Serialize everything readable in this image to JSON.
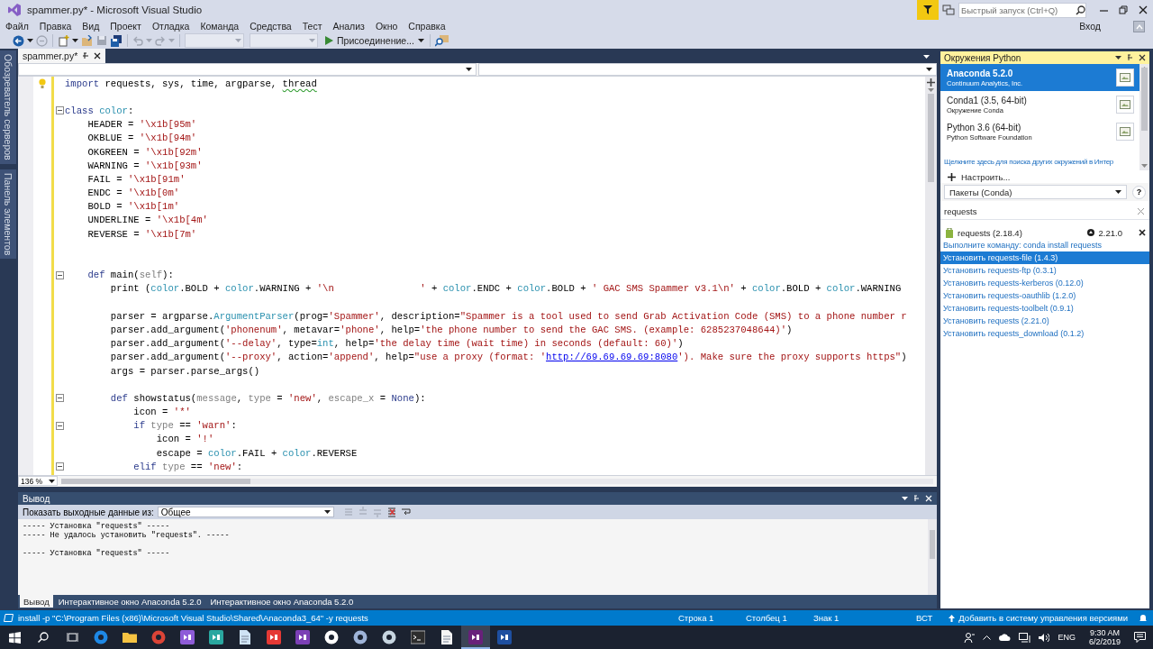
{
  "window": {
    "title": "spammer.py* - Microsoft Visual Studio",
    "quick_launch": {
      "placeholder": "Быстрый запуск (Ctrl+Q)"
    },
    "sign_in": "Вход"
  },
  "menu": [
    "Файл",
    "Правка",
    "Вид",
    "Проект",
    "Отладка",
    "Команда",
    "Средства",
    "Тест",
    "Анализ",
    "Окно",
    "Справка"
  ],
  "toolbar": {
    "start_button": "Присоединение..."
  },
  "side_tabs": [
    "Обозреватель серверов",
    "Панель элементов"
  ],
  "document_tabs": [
    {
      "label": "spammer.py*",
      "selected": true
    }
  ],
  "editor": {
    "zoom": "136 %",
    "lines": [
      {
        "fold": false,
        "tokens": [
          {
            "kind": "kw",
            "text": "import"
          },
          {
            "kind": "plain",
            "text": " requests, sys, time, argparse, "
          },
          {
            "kind": "warn",
            "text": "thread"
          }
        ]
      },
      {
        "fold": false
      },
      {
        "fold": true,
        "tokens": [
          {
            "kind": "kw",
            "text": "class"
          },
          {
            "kind": "cls",
            "text": " color"
          },
          {
            "kind": "plain",
            "text": ":"
          }
        ]
      },
      {
        "fold": false,
        "tokens": [
          {
            "kind": "plain",
            "text": "    HEADER = "
          },
          {
            "kind": "str",
            "text": "'\\x1b[95m'"
          }
        ]
      },
      {
        "fold": false,
        "tokens": [
          {
            "kind": "plain",
            "text": "    OKBLUE = "
          },
          {
            "kind": "str",
            "text": "'\\x1b[94m'"
          }
        ]
      },
      {
        "fold": false,
        "tokens": [
          {
            "kind": "plain",
            "text": "    OKGREEN = "
          },
          {
            "kind": "str",
            "text": "'\\x1b[92m'"
          }
        ]
      },
      {
        "fold": false,
        "tokens": [
          {
            "kind": "plain",
            "text": "    WARNING = "
          },
          {
            "kind": "str",
            "text": "'\\x1b[93m'"
          }
        ]
      },
      {
        "fold": false,
        "tokens": [
          {
            "kind": "plain",
            "text": "    FAIL = "
          },
          {
            "kind": "str",
            "text": "'\\x1b[91m'"
          }
        ]
      },
      {
        "fold": false,
        "tokens": [
          {
            "kind": "plain",
            "text": "    ENDC = "
          },
          {
            "kind": "str",
            "text": "'\\x1b[0m'"
          }
        ]
      },
      {
        "fold": false,
        "tokens": [
          {
            "kind": "plain",
            "text": "    BOLD = "
          },
          {
            "kind": "str",
            "text": "'\\x1b[1m'"
          }
        ]
      },
      {
        "fold": false,
        "tokens": [
          {
            "kind": "plain",
            "text": "    UNDERLINE = "
          },
          {
            "kind": "str",
            "text": "'\\x1b[4m'"
          }
        ]
      },
      {
        "fold": false,
        "tokens": [
          {
            "kind": "plain",
            "text": "    REVERSE = "
          },
          {
            "kind": "str",
            "text": "'\\x1b[7m'"
          }
        ]
      },
      {
        "fold": false
      },
      {
        "fold": false
      },
      {
        "fold": true,
        "tokens": [
          {
            "kind": "kw",
            "text": "    def"
          },
          {
            "kind": "plain",
            "text": " main("
          },
          {
            "kind": "param",
            "text": "self"
          },
          {
            "kind": "plain",
            "text": "):"
          }
        ]
      },
      {
        "fold": false,
        "tokens": [
          {
            "kind": "plain",
            "text": "        print ("
          },
          {
            "kind": "cls",
            "text": "color"
          },
          {
            "kind": "plain",
            "text": ".BOLD + "
          },
          {
            "kind": "cls",
            "text": "color"
          },
          {
            "kind": "plain",
            "text": ".WARNING + "
          },
          {
            "kind": "str",
            "text": "'\\n               '"
          },
          {
            "kind": "plain",
            "text": " + "
          },
          {
            "kind": "cls",
            "text": "color"
          },
          {
            "kind": "plain",
            "text": ".ENDC + "
          },
          {
            "kind": "cls",
            "text": "color"
          },
          {
            "kind": "plain",
            "text": ".BOLD + "
          },
          {
            "kind": "str",
            "text": "' GAC SMS Spammer v3.1\\n'"
          },
          {
            "kind": "plain",
            "text": " + "
          },
          {
            "kind": "cls",
            "text": "color"
          },
          {
            "kind": "plain",
            "text": ".BOLD + "
          },
          {
            "kind": "cls",
            "text": "color"
          },
          {
            "kind": "plain",
            "text": ".WARNING"
          }
        ]
      },
      {
        "fold": false
      },
      {
        "fold": false,
        "tokens": [
          {
            "kind": "plain",
            "text": "        parser = argparse."
          },
          {
            "kind": "cls",
            "text": "ArgumentParser"
          },
          {
            "kind": "plain",
            "text": "(prog="
          },
          {
            "kind": "str",
            "text": "'Spammer'"
          },
          {
            "kind": "plain",
            "text": ", description="
          },
          {
            "kind": "str",
            "text": "\"Spammer is a tool used to send Grab Activation Code (SMS) to a phone number r"
          }
        ]
      },
      {
        "fold": false,
        "tokens": [
          {
            "kind": "plain",
            "text": "        parser.add_argument("
          },
          {
            "kind": "str",
            "text": "'phonenum'"
          },
          {
            "kind": "plain",
            "text": ", metavar="
          },
          {
            "kind": "str",
            "text": "'phone'"
          },
          {
            "kind": "plain",
            "text": ", help="
          },
          {
            "kind": "str",
            "text": "'the phone number to send the GAC SMS. (example: 6285237048644)'"
          },
          {
            "kind": "plain",
            "text": ")"
          }
        ]
      },
      {
        "fold": false,
        "tokens": [
          {
            "kind": "plain",
            "text": "        parser.add_argument("
          },
          {
            "kind": "str",
            "text": "'--delay'"
          },
          {
            "kind": "plain",
            "text": ", type="
          },
          {
            "kind": "cls",
            "text": "int"
          },
          {
            "kind": "plain",
            "text": ", help="
          },
          {
            "kind": "str",
            "text": "'the delay time (wait time) in seconds (default: 60)'"
          },
          {
            "kind": "plain",
            "text": ")"
          }
        ]
      },
      {
        "fold": false,
        "tokens": [
          {
            "kind": "plain",
            "text": "        parser.add_argument("
          },
          {
            "kind": "str",
            "text": "'--proxy'"
          },
          {
            "kind": "plain",
            "text": ", action="
          },
          {
            "kind": "str",
            "text": "'append'"
          },
          {
            "kind": "plain",
            "text": ", help="
          },
          {
            "kind": "str",
            "text": "\"use a proxy (format: '"
          },
          {
            "kind": "link",
            "text": "http://69.69.69.69:8080"
          },
          {
            "kind": "str",
            "text": "'). Make sure the proxy supports https\""
          },
          {
            "kind": "plain",
            "text": ")"
          }
        ]
      },
      {
        "fold": false,
        "tokens": [
          {
            "kind": "plain",
            "text": "        args = parser.parse_args()"
          }
        ]
      },
      {
        "fold": false
      },
      {
        "fold": true,
        "tokens": [
          {
            "kind": "kw",
            "text": "        def"
          },
          {
            "kind": "plain",
            "text": " showstatus("
          },
          {
            "kind": "param",
            "text": "message"
          },
          {
            "kind": "plain",
            "text": ", "
          },
          {
            "kind": "param",
            "text": "type"
          },
          {
            "kind": "plain",
            "text": " = "
          },
          {
            "kind": "str",
            "text": "'new'"
          },
          {
            "kind": "plain",
            "text": ", "
          },
          {
            "kind": "param",
            "text": "escape_x"
          },
          {
            "kind": "plain",
            "text": " = "
          },
          {
            "kind": "kw",
            "text": "None"
          },
          {
            "kind": "plain",
            "text": "):"
          }
        ]
      },
      {
        "fold": false,
        "tokens": [
          {
            "kind": "plain",
            "text": "            icon = "
          },
          {
            "kind": "str",
            "text": "'*'"
          }
        ]
      },
      {
        "fold": true,
        "tokens": [
          {
            "kind": "kw",
            "text": "            if"
          },
          {
            "kind": "param",
            "text": " type"
          },
          {
            "kind": "plain",
            "text": " == "
          },
          {
            "kind": "str",
            "text": "'warn'"
          },
          {
            "kind": "plain",
            "text": ":"
          }
        ]
      },
      {
        "fold": false,
        "tokens": [
          {
            "kind": "plain",
            "text": "                icon = "
          },
          {
            "kind": "str",
            "text": "'!'"
          }
        ]
      },
      {
        "fold": false,
        "tokens": [
          {
            "kind": "plain",
            "text": "                escape = "
          },
          {
            "kind": "cls",
            "text": "color"
          },
          {
            "kind": "plain",
            "text": ".FAIL + "
          },
          {
            "kind": "cls",
            "text": "color"
          },
          {
            "kind": "plain",
            "text": ".REVERSE"
          }
        ]
      },
      {
        "fold": true,
        "tokens": [
          {
            "kind": "kw",
            "text": "            elif"
          },
          {
            "kind": "param",
            "text": " type"
          },
          {
            "kind": "plain",
            "text": " == "
          },
          {
            "kind": "str",
            "text": "'new'"
          },
          {
            "kind": "plain",
            "text": ":"
          }
        ]
      }
    ]
  },
  "output": {
    "title": "Вывод",
    "source_label": "Показать выходные данные из:",
    "source": "Общее",
    "blocks": [
      [
        "----- Установка \"requests\" -----",
        "----- Не удалось установить \"requests\". -----"
      ],
      [
        "----- Установка \"requests\" -----"
      ]
    ],
    "tabs": [
      {
        "label": "Вывод",
        "selected": true
      },
      {
        "label": "Интерактивное окно Anaconda 5.2.0",
        "selected": false
      },
      {
        "label": "Интерактивное окно Anaconda 5.2.0",
        "selected": false
      }
    ]
  },
  "python_environments": {
    "title": "Окружения Python",
    "environments": [
      {
        "name": "Anaconda 5.2.0",
        "description": "Continuum Analytics, Inc.",
        "selected": true
      },
      {
        "name": "Conda1 (3.5, 64-bit)",
        "description": "Окружение Conda",
        "selected": false
      },
      {
        "name": "Python 3.6 (64-bit)",
        "description": "Python Software Foundation",
        "selected": false
      }
    ],
    "search_online_link": "Щелкните здесь для поиска других окружений в Интер",
    "configure": "Настроить...",
    "view_select": "Пакеты (Conda)",
    "help": "?",
    "search": {
      "value": "requests"
    },
    "installed": [
      {
        "name": "requests (2.18.4)",
        "update": "2.21.0"
      }
    ],
    "command_link": "Выполните команду: conda install requests",
    "install_items": [
      {
        "label": "Установить requests-file (1.4.3)",
        "selected": true
      },
      {
        "label": "Установить requests-ftp (0.3.1)",
        "selected": false
      },
      {
        "label": "Установить requests-kerberos (0.12.0)",
        "selected": false
      },
      {
        "label": "Установить requests-oauthlib (1.2.0)",
        "selected": false
      },
      {
        "label": "Установить requests-toolbelt (0.9.1)",
        "selected": false
      },
      {
        "label": "Установить requests (2.21.0)",
        "selected": false
      },
      {
        "label": "Установить requests_download (0.1.2)",
        "selected": false
      }
    ]
  },
  "status_bar": {
    "message": "install -p \"C:\\Program Files (x86)\\Microsoft Visual Studio\\Shared\\Anaconda3_64\" -y requests",
    "line": "Строка 1",
    "column": "Столбец 1",
    "char": "Знак 1",
    "mode": "ВСТ",
    "source_control": "Добавить в систему управления версиями"
  },
  "taskbar": {
    "apps": [
      {
        "kind": "circle",
        "color": "#1e88e5",
        "selected": false
      },
      {
        "kind": "folder",
        "color": "#f6c342",
        "selected": false
      },
      {
        "kind": "circle",
        "color": "#db4437",
        "selected": false
      },
      {
        "kind": "tile",
        "color": "#8e5cd8",
        "selected": false
      },
      {
        "kind": "tile",
        "color": "#2aa7a0",
        "selected": false
      },
      {
        "kind": "page",
        "color": "#cfe3f5",
        "selected": false
      },
      {
        "kind": "tile",
        "color": "#e53935",
        "selected": false
      },
      {
        "kind": "tile",
        "color": "#7b3fb5",
        "selected": false
      },
      {
        "kind": "circle",
        "color": "#ffffff",
        "selected": false
      },
      {
        "kind": "circle",
        "color": "#9fb4d8",
        "selected": false
      },
      {
        "kind": "circle",
        "color": "#c7d5e0",
        "selected": false
      },
      {
        "kind": "terminal",
        "color": "#2d2d2d",
        "selected": false
      },
      {
        "kind": "page",
        "color": "#f5f5f5",
        "selected": false
      },
      {
        "kind": "tile",
        "color": "#68217a",
        "selected": true
      },
      {
        "kind": "tile",
        "color": "#1e4fa0",
        "selected": false
      }
    ],
    "language": "ENG",
    "time": "9:30 AM",
    "date": "6/2/2019"
  }
}
